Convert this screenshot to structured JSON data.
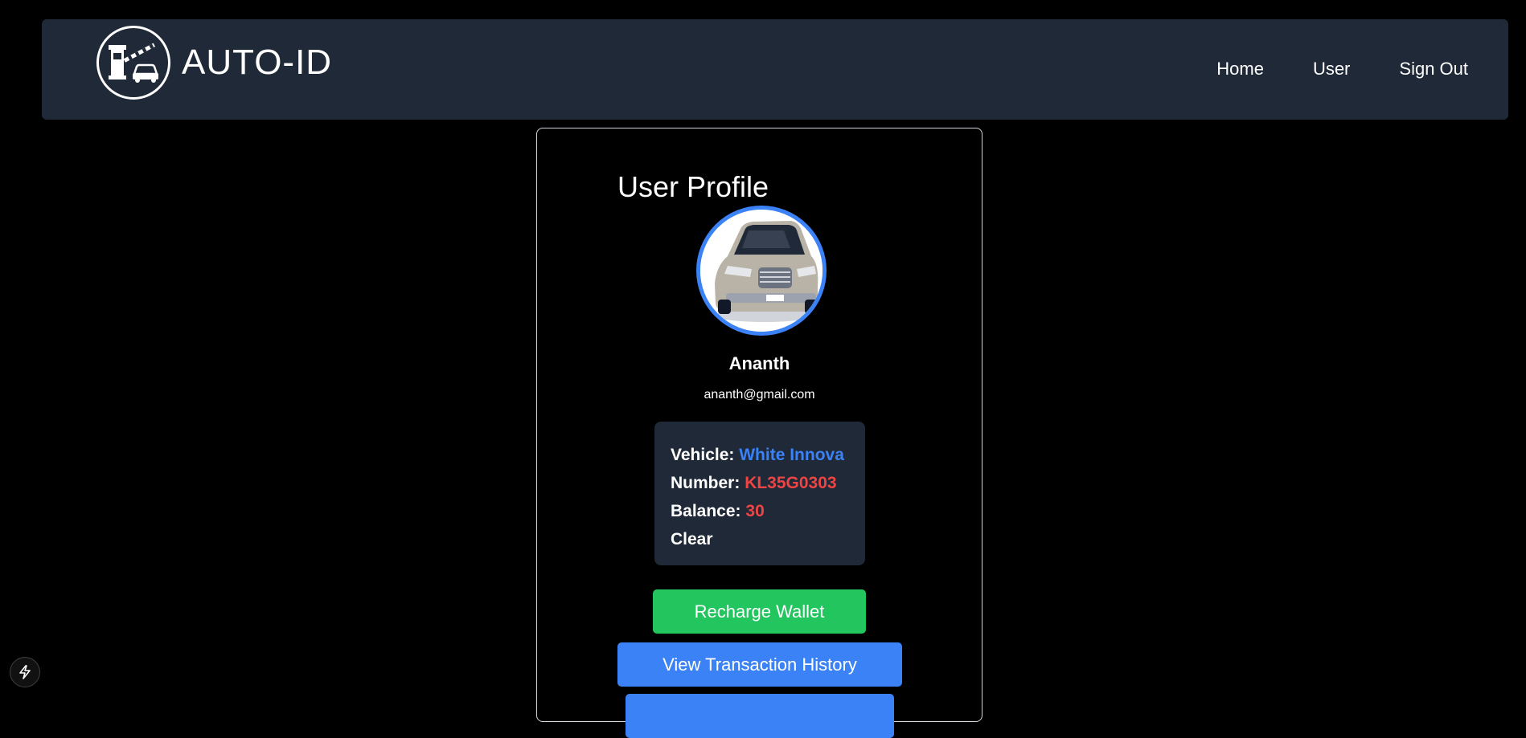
{
  "header": {
    "logo_icon": "toll-gate-car-icon",
    "brand": "AUTO-ID",
    "nav": [
      {
        "label": "Home"
      },
      {
        "label": "User"
      },
      {
        "label": "Sign Out"
      }
    ]
  },
  "profile": {
    "title": "User Profile",
    "avatar_icon": "car-photo",
    "name": "Ananth",
    "email": "ananth@gmail.com",
    "details": {
      "vehicle_label": "Vehicle:",
      "vehicle_value": "White Innova",
      "number_label": "Number:",
      "number_value": "KL35G0303",
      "balance_label": "Balance:",
      "balance_value": "30",
      "status": "Clear"
    },
    "buttons": {
      "recharge": "Recharge Wallet",
      "history": "View Transaction History"
    }
  },
  "colors": {
    "navbar_bg": "#1f2937",
    "accent_blue": "#3b82f6",
    "accent_red": "#ef4444",
    "accent_green": "#22c55e"
  },
  "dev_badge_icon": "lightning-icon"
}
